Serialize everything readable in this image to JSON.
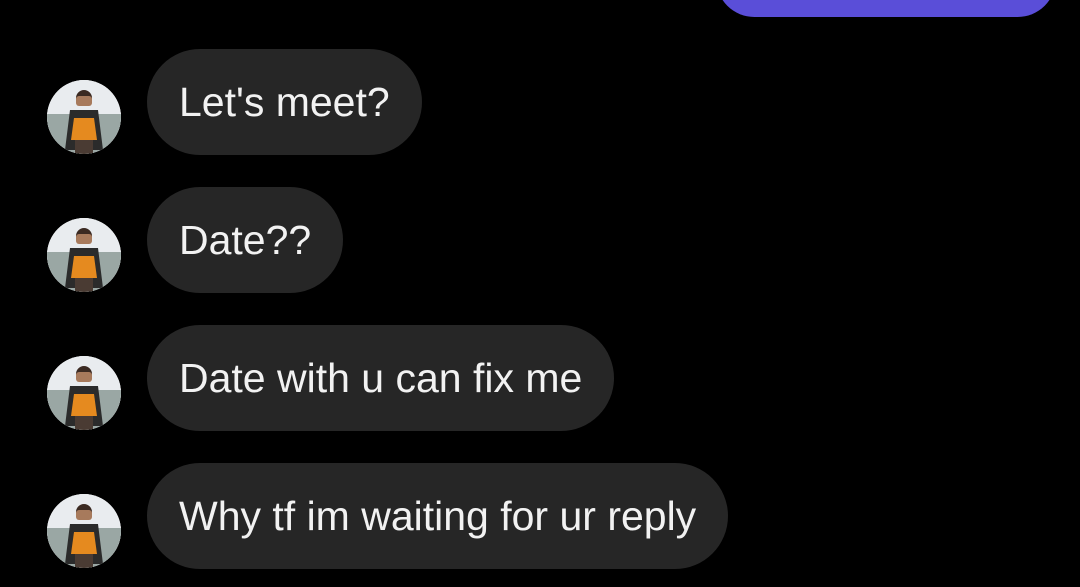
{
  "colors": {
    "background": "#000000",
    "sent_bubble": "#5a4ed8",
    "received_bubble": "#262626",
    "text": "#f2f2f2"
  },
  "messages": [
    {
      "text": "Let's meet?"
    },
    {
      "text": "Date??"
    },
    {
      "text": "Date with u can fix me"
    },
    {
      "text": "Why tf im waiting for ur reply"
    }
  ]
}
